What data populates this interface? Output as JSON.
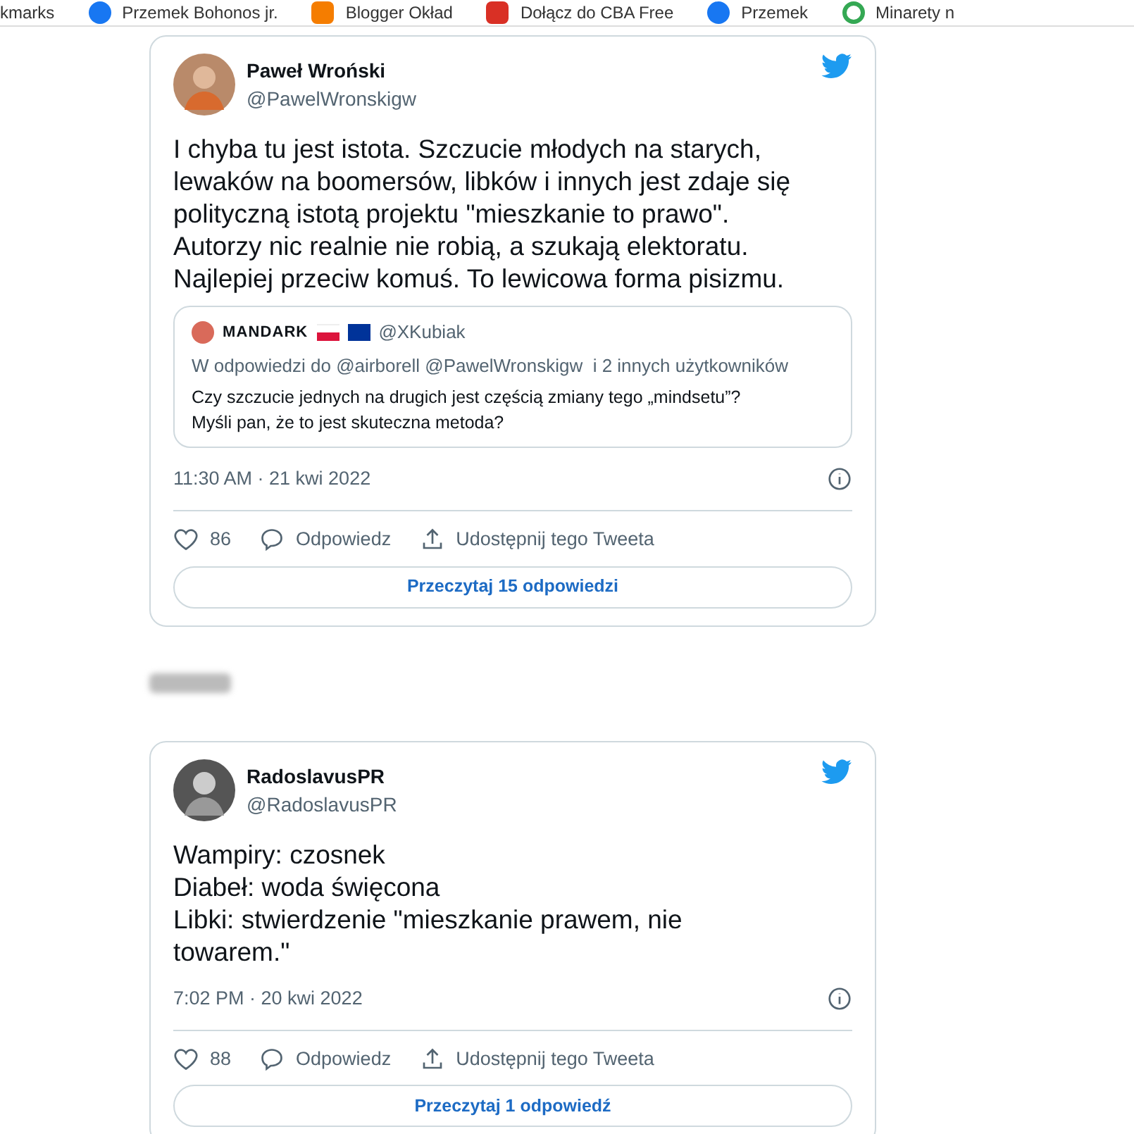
{
  "bookmarks": [
    {
      "label": "kmarks",
      "kind": "text"
    },
    {
      "label": "Przemek Bohonos jr.",
      "kind": "facebook"
    },
    {
      "label": "Blogger Okład",
      "kind": "blogger"
    },
    {
      "label": "Dołącz do CBA Free",
      "kind": "cba"
    },
    {
      "label": "Przemek",
      "kind": "facebook"
    },
    {
      "label": "Minarety n",
      "kind": "google"
    }
  ],
  "tweets": [
    {
      "name": "Paweł Wroński",
      "handle": "@PawelWronskigw",
      "text": [
        "I chyba tu jest istota. Szczucie młodych na starych, lewaków na boomersów, libków i innych jest zdaje się polityczną istotą projektu \"mieszkanie to prawo\". Autorzy nic realnie nie robią, a szukają elektoratu. Najlepiej przeciw komuś. To lewicowa forma pisizmu."
      ],
      "quote": {
        "name": "MANDARK",
        "handle": "@XKubiak",
        "reply_to": "W odpowiedzi do @airborell @PawelWronskigw  i 2 innych użytkowników",
        "text": "Czy szczucie jednych na drugich jest częścią zmiany tego „mindsetu”? Myśli pan, że to jest skuteczna metoda?"
      },
      "time": "11:30 AM · 21 kwi 2022",
      "likes": "86",
      "reply": "Odpowiedz",
      "share": "Udostępnij tego Tweeta",
      "read": "Przeczytaj 15 odpowiedzi"
    },
    {
      "name": "RadoslavusPR",
      "handle": "@RadoslavusPR",
      "text": [
        "Wampiry: czosnek",
        "Diabeł: woda święcona",
        "Libki: stwierdzenie \"mieszkanie prawem, nie towarem.\""
      ],
      "time": "7:02 PM · 20 kwi 2022",
      "likes": "88",
      "reply": "Odpowiedz",
      "share": "Udostępnij tego Tweeta",
      "read": "Przeczytaj 1 odpowiedź"
    }
  ]
}
